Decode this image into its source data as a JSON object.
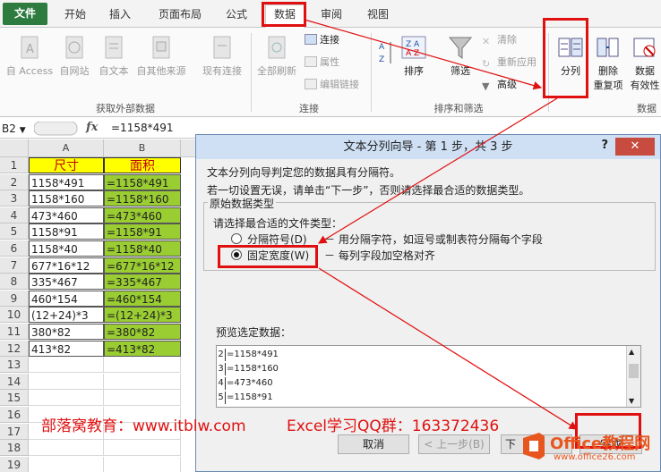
{
  "ribbon_tabs": [
    "文件",
    "开始",
    "插入",
    "页面布局",
    "公式",
    "数据",
    "审阅",
    "视图"
  ],
  "ribbon": {
    "get_external": [
      "自 Access",
      "自网站",
      "自文本",
      "自其他来源",
      "现有连接"
    ],
    "get_external_group": "获取外部数据",
    "refresh_all": "全部刷新",
    "connections": [
      "连接",
      "属性",
      "编辑链接"
    ],
    "connections_group": "连接",
    "sort": "排序",
    "filter": "筛选",
    "advanced_filter": [
      "清除",
      "重新应用",
      "高级"
    ],
    "sort_filter_group": "排序和筛选",
    "text_to_columns": "分列",
    "remove_duplicates": [
      "删除",
      "重复项"
    ],
    "data_validation": [
      "数据",
      "有效性"
    ],
    "data_tools_group": "数据"
  },
  "formula_bar": {
    "name_box": "B2",
    "fx": "fx",
    "formula": "=1158*491"
  },
  "sheet": {
    "columns": [
      "A",
      "B"
    ],
    "rows": [
      "1",
      "2",
      "3",
      "4",
      "5",
      "6",
      "7",
      "8",
      "9",
      "10",
      "11",
      "12",
      "13",
      "14",
      "15",
      "16",
      "17",
      "18",
      "19"
    ],
    "header": [
      "尺寸",
      "面积"
    ],
    "data": [
      [
        "1158*491",
        "=1158*491"
      ],
      [
        "1158*160",
        "=1158*160"
      ],
      [
        "473*460",
        "=473*460"
      ],
      [
        "1158*91",
        "=1158*91"
      ],
      [
        "1158*40",
        "=1158*40"
      ],
      [
        "677*16*12",
        "=677*16*12"
      ],
      [
        "335*467",
        "=335*467"
      ],
      [
        "460*154",
        "=460*154"
      ],
      [
        "(12+24)*3",
        "=(12+24)*3"
      ],
      [
        "380*82",
        "=380*82"
      ],
      [
        "413*82",
        "=413*82"
      ]
    ]
  },
  "dialog": {
    "title": "文本分列向导 - 第 1 步，共 3 步",
    "help": "?",
    "close": "✕",
    "line1": "文本分列向导判定您的数据具有分隔符。",
    "line2": "若一切设置无误，请单击“下一步”，否则请选择最合适的数据类型。",
    "group_label": "原始数据类型",
    "prompt": "请选择最合适的文件类型：",
    "option1_label": "分隔符号(D)",
    "option1_desc": "－ 用分隔字符，如逗号或制表符分隔每个字段",
    "option2_label": "固定宽度(W)",
    "option2_desc": "－ 每列字段加空格对齐",
    "preview_label": "预览选定数据：",
    "preview_rows": [
      [
        "2",
        "=1158*491"
      ],
      [
        "3",
        "=1158*160"
      ],
      [
        "4",
        "=473*460"
      ],
      [
        "5",
        "=1158*91"
      ]
    ],
    "buttons": {
      "cancel": "取消",
      "back": "< 上一步(B)",
      "next": "下",
      "finish": "完成"
    }
  },
  "watermark": {
    "left": "部落窝教育：www.itblw.com",
    "right": "Excel学习QQ群：163372436",
    "logo_main": "Office教程网",
    "logo_url": "www.office26.com"
  },
  "colors": {
    "highlight": "#e01010",
    "header_fill": "#ffff00",
    "formula_fill": "#9acd32",
    "file_tab": "#2e7b3f"
  }
}
